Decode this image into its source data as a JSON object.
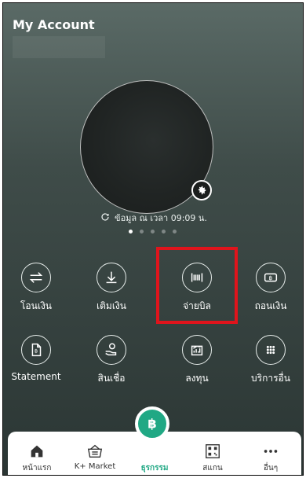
{
  "header": {
    "title": "My Account"
  },
  "status": {
    "updated_text": "ข้อมูล ณ เวลา 09:09 น."
  },
  "carousel": {
    "total": 5,
    "active": 0
  },
  "actions": [
    {
      "label": "โอนเงิน",
      "icon": "transfer-icon"
    },
    {
      "label": "เติมเงิน",
      "icon": "topup-icon"
    },
    {
      "label": "จ่ายบิล",
      "icon": "pay-bill-icon"
    },
    {
      "label": "ถอนเงิน",
      "icon": "withdraw-icon"
    },
    {
      "label": "Statement",
      "icon": "statement-icon"
    },
    {
      "label": "สินเชื่อ",
      "icon": "loan-icon"
    },
    {
      "label": "ลงทุน",
      "icon": "invest-icon"
    },
    {
      "label": "บริการอื่น",
      "icon": "other-services-icon"
    }
  ],
  "bottom_nav": [
    {
      "label": "หน้าแรก",
      "icon": "home-icon"
    },
    {
      "label": "K+ Market",
      "icon": "market-icon"
    },
    {
      "label": "ธุรกรรม",
      "icon": "baht-icon"
    },
    {
      "label": "สแกน",
      "icon": "scan-icon"
    },
    {
      "label": "อื่นๆ",
      "icon": "more-icon"
    }
  ],
  "colors": {
    "accent": "#20a884",
    "highlight": "#e0141c"
  }
}
